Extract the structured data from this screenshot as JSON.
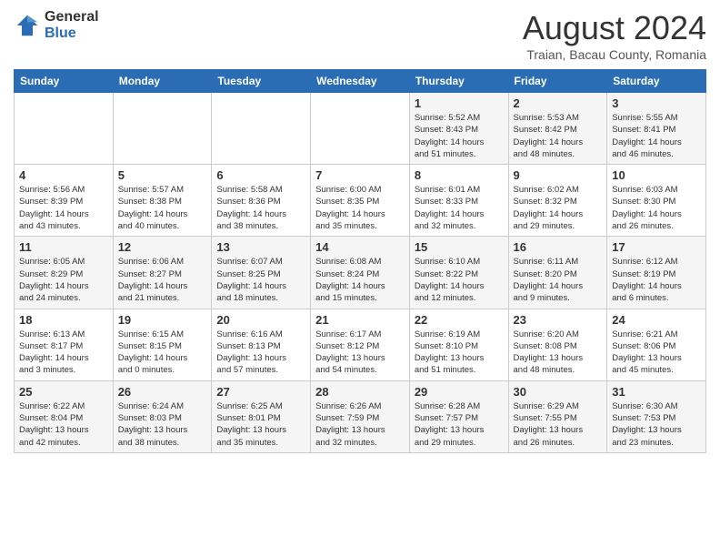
{
  "logo": {
    "general": "General",
    "blue": "Blue"
  },
  "header": {
    "month_year": "August 2024",
    "subtitle": "Traian, Bacau County, Romania"
  },
  "weekdays": [
    "Sunday",
    "Monday",
    "Tuesday",
    "Wednesday",
    "Thursday",
    "Friday",
    "Saturday"
  ],
  "weeks": [
    [
      {
        "day": "",
        "info": ""
      },
      {
        "day": "",
        "info": ""
      },
      {
        "day": "",
        "info": ""
      },
      {
        "day": "",
        "info": ""
      },
      {
        "day": "1",
        "info": "Sunrise: 5:52 AM\nSunset: 8:43 PM\nDaylight: 14 hours\nand 51 minutes."
      },
      {
        "day": "2",
        "info": "Sunrise: 5:53 AM\nSunset: 8:42 PM\nDaylight: 14 hours\nand 48 minutes."
      },
      {
        "day": "3",
        "info": "Sunrise: 5:55 AM\nSunset: 8:41 PM\nDaylight: 14 hours\nand 46 minutes."
      }
    ],
    [
      {
        "day": "4",
        "info": "Sunrise: 5:56 AM\nSunset: 8:39 PM\nDaylight: 14 hours\nand 43 minutes."
      },
      {
        "day": "5",
        "info": "Sunrise: 5:57 AM\nSunset: 8:38 PM\nDaylight: 14 hours\nand 40 minutes."
      },
      {
        "day": "6",
        "info": "Sunrise: 5:58 AM\nSunset: 8:36 PM\nDaylight: 14 hours\nand 38 minutes."
      },
      {
        "day": "7",
        "info": "Sunrise: 6:00 AM\nSunset: 8:35 PM\nDaylight: 14 hours\nand 35 minutes."
      },
      {
        "day": "8",
        "info": "Sunrise: 6:01 AM\nSunset: 8:33 PM\nDaylight: 14 hours\nand 32 minutes."
      },
      {
        "day": "9",
        "info": "Sunrise: 6:02 AM\nSunset: 8:32 PM\nDaylight: 14 hours\nand 29 minutes."
      },
      {
        "day": "10",
        "info": "Sunrise: 6:03 AM\nSunset: 8:30 PM\nDaylight: 14 hours\nand 26 minutes."
      }
    ],
    [
      {
        "day": "11",
        "info": "Sunrise: 6:05 AM\nSunset: 8:29 PM\nDaylight: 14 hours\nand 24 minutes."
      },
      {
        "day": "12",
        "info": "Sunrise: 6:06 AM\nSunset: 8:27 PM\nDaylight: 14 hours\nand 21 minutes."
      },
      {
        "day": "13",
        "info": "Sunrise: 6:07 AM\nSunset: 8:25 PM\nDaylight: 14 hours\nand 18 minutes."
      },
      {
        "day": "14",
        "info": "Sunrise: 6:08 AM\nSunset: 8:24 PM\nDaylight: 14 hours\nand 15 minutes."
      },
      {
        "day": "15",
        "info": "Sunrise: 6:10 AM\nSunset: 8:22 PM\nDaylight: 14 hours\nand 12 minutes."
      },
      {
        "day": "16",
        "info": "Sunrise: 6:11 AM\nSunset: 8:20 PM\nDaylight: 14 hours\nand 9 minutes."
      },
      {
        "day": "17",
        "info": "Sunrise: 6:12 AM\nSunset: 8:19 PM\nDaylight: 14 hours\nand 6 minutes."
      }
    ],
    [
      {
        "day": "18",
        "info": "Sunrise: 6:13 AM\nSunset: 8:17 PM\nDaylight: 14 hours\nand 3 minutes."
      },
      {
        "day": "19",
        "info": "Sunrise: 6:15 AM\nSunset: 8:15 PM\nDaylight: 14 hours\nand 0 minutes."
      },
      {
        "day": "20",
        "info": "Sunrise: 6:16 AM\nSunset: 8:13 PM\nDaylight: 13 hours\nand 57 minutes."
      },
      {
        "day": "21",
        "info": "Sunrise: 6:17 AM\nSunset: 8:12 PM\nDaylight: 13 hours\nand 54 minutes."
      },
      {
        "day": "22",
        "info": "Sunrise: 6:19 AM\nSunset: 8:10 PM\nDaylight: 13 hours\nand 51 minutes."
      },
      {
        "day": "23",
        "info": "Sunrise: 6:20 AM\nSunset: 8:08 PM\nDaylight: 13 hours\nand 48 minutes."
      },
      {
        "day": "24",
        "info": "Sunrise: 6:21 AM\nSunset: 8:06 PM\nDaylight: 13 hours\nand 45 minutes."
      }
    ],
    [
      {
        "day": "25",
        "info": "Sunrise: 6:22 AM\nSunset: 8:04 PM\nDaylight: 13 hours\nand 42 minutes."
      },
      {
        "day": "26",
        "info": "Sunrise: 6:24 AM\nSunset: 8:03 PM\nDaylight: 13 hours\nand 38 minutes."
      },
      {
        "day": "27",
        "info": "Sunrise: 6:25 AM\nSunset: 8:01 PM\nDaylight: 13 hours\nand 35 minutes."
      },
      {
        "day": "28",
        "info": "Sunrise: 6:26 AM\nSunset: 7:59 PM\nDaylight: 13 hours\nand 32 minutes."
      },
      {
        "day": "29",
        "info": "Sunrise: 6:28 AM\nSunset: 7:57 PM\nDaylight: 13 hours\nand 29 minutes."
      },
      {
        "day": "30",
        "info": "Sunrise: 6:29 AM\nSunset: 7:55 PM\nDaylight: 13 hours\nand 26 minutes."
      },
      {
        "day": "31",
        "info": "Sunrise: 6:30 AM\nSunset: 7:53 PM\nDaylight: 13 hours\nand 23 minutes."
      }
    ]
  ]
}
